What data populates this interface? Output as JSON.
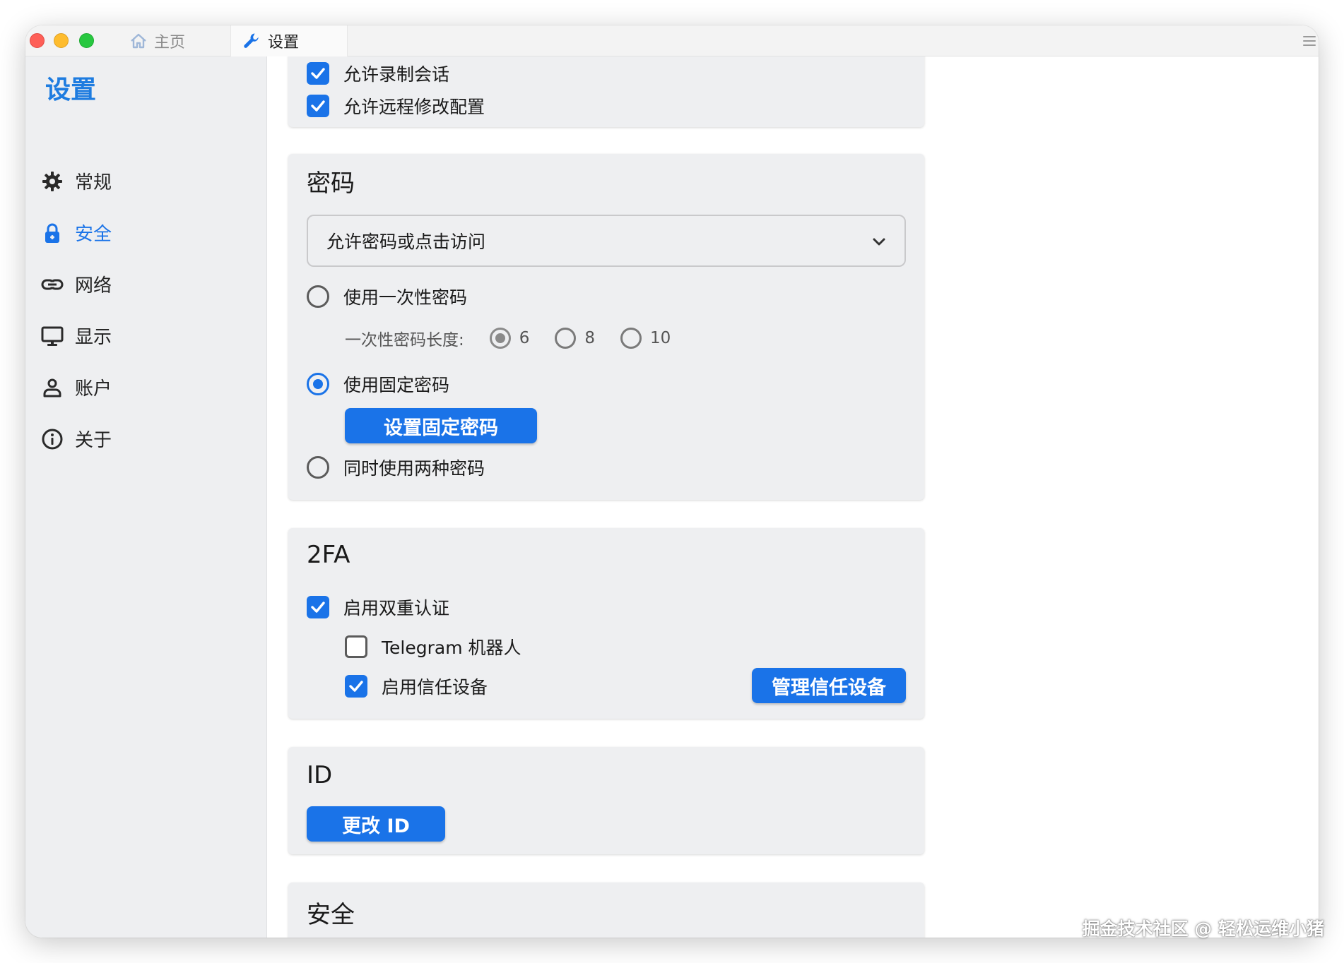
{
  "tabs": {
    "home": "主页",
    "settings": "设置"
  },
  "sidebar": {
    "title": "设置",
    "items": [
      {
        "label": "常规",
        "icon": "gear-icon"
      },
      {
        "label": "安全",
        "icon": "lock-icon",
        "active": true
      },
      {
        "label": "网络",
        "icon": "link-icon"
      },
      {
        "label": "显示",
        "icon": "monitor-icon"
      },
      {
        "label": "账户",
        "icon": "person-icon"
      },
      {
        "label": "关于",
        "icon": "info-icon"
      }
    ]
  },
  "permissions": {
    "allow_record": "允许录制会话",
    "allow_remote_config": "允许远程修改配置"
  },
  "password": {
    "title": "密码",
    "mode_select": "允许密码或点击访问",
    "use_otp": "使用一次性密码",
    "otp_length_label": "一次性密码长度:",
    "otp_lengths": [
      "6",
      "8",
      "10"
    ],
    "otp_length_selected": "6",
    "use_fixed": "使用固定密码",
    "set_fixed_button": "设置固定密码",
    "use_both": "同时使用两种密码",
    "selected_mode": "use_fixed"
  },
  "twofa": {
    "title": "2FA",
    "enable_2fa": "启用双重认证",
    "telegram_bot": "Telegram 机器人",
    "enable_trusted": "启用信任设备",
    "manage_trusted_button": "管理信任设备"
  },
  "id_section": {
    "title": "ID",
    "change_id_button": "更改 ID"
  },
  "next_section_title": "安全",
  "watermark": "掘金技术社区 @ 轻松运维小猪",
  "colors": {
    "accent": "#1a73e8",
    "sidebar_bg": "#eeeff1",
    "card_bg": "#eeeff1"
  }
}
